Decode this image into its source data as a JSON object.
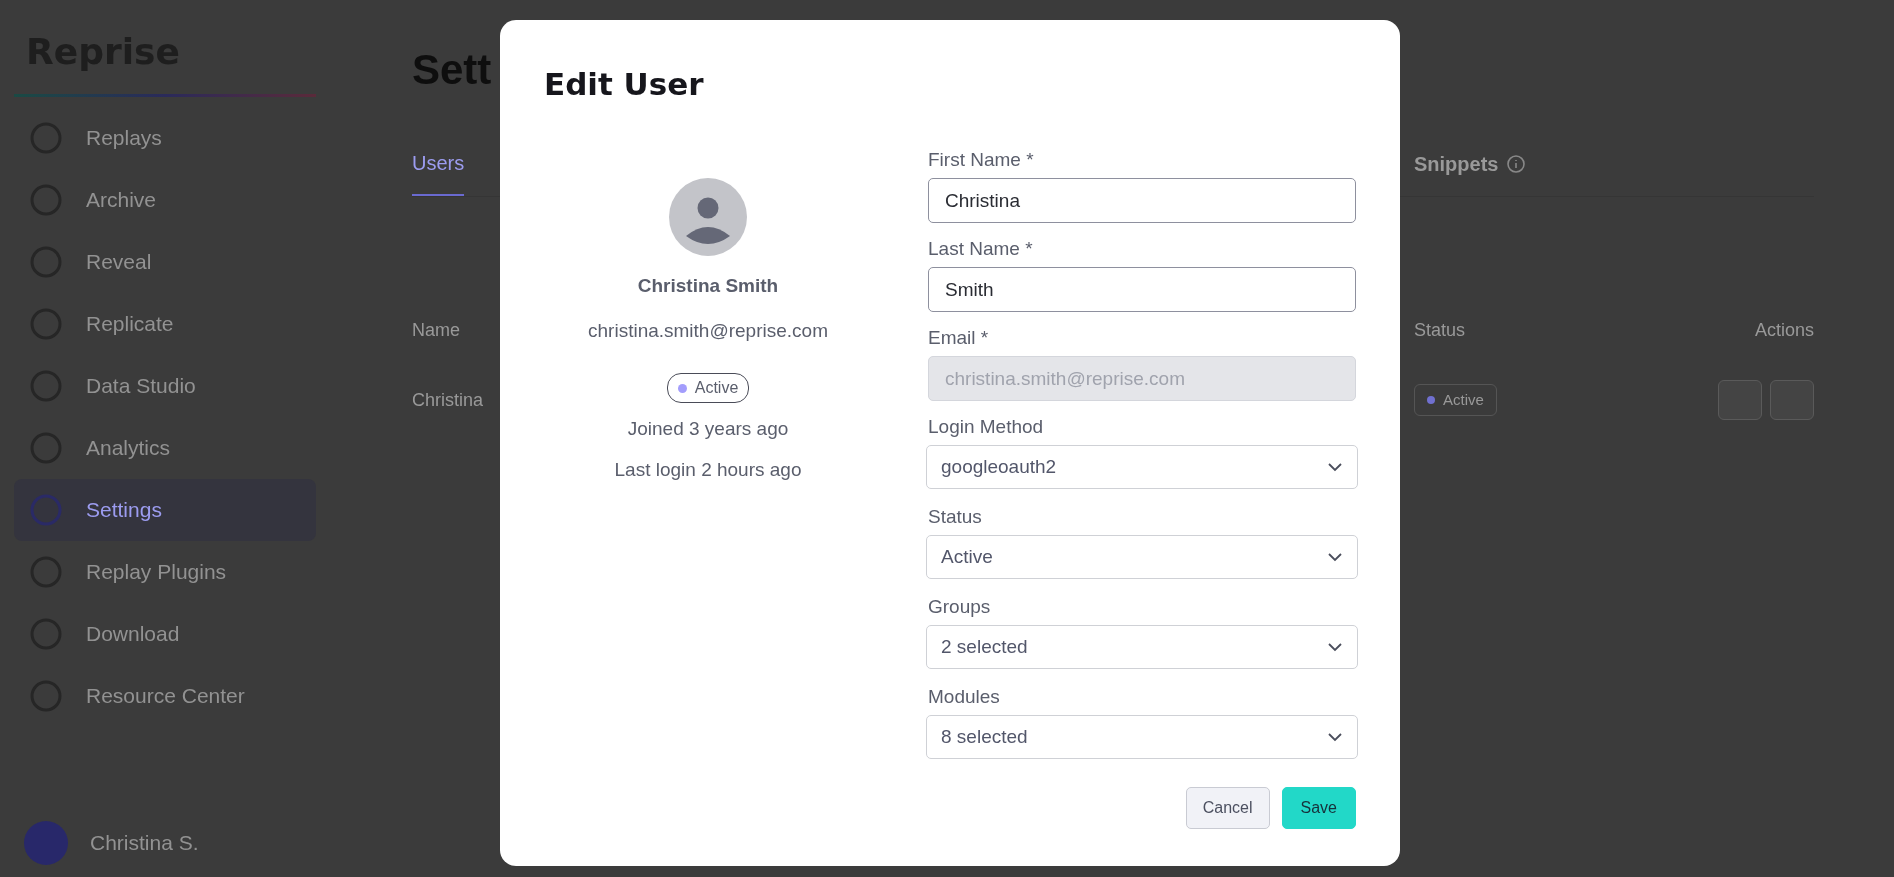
{
  "background": {
    "logo": "Reprise",
    "sidebar": {
      "items": [
        {
          "label": "Replays",
          "selected": false
        },
        {
          "label": "Archive",
          "selected": false
        },
        {
          "label": "Reveal",
          "selected": false
        },
        {
          "label": "Replicate",
          "selected": false
        },
        {
          "label": "Data Studio",
          "selected": false
        },
        {
          "label": "Analytics",
          "selected": false
        },
        {
          "label": "Settings",
          "selected": true
        },
        {
          "label": "Replay Plugins",
          "selected": false
        },
        {
          "label": "Download",
          "selected": false
        },
        {
          "label": "Resource Center",
          "selected": false
        }
      ],
      "user": "Christina S."
    },
    "page_title": "Sett",
    "tabs": [
      {
        "label": "Users",
        "selected": true
      },
      {
        "label": "Snippets",
        "selected": false
      }
    ],
    "table": {
      "columns": [
        "Name",
        "Status",
        "Actions"
      ],
      "rows": [
        {
          "name": "Christina",
          "status": "Active"
        }
      ]
    }
  },
  "modal": {
    "title": "Edit User",
    "profile": {
      "name": "Christina Smith",
      "email": "christina.smith@reprise.com",
      "status": "Active",
      "joined": "Joined 3 years ago",
      "last_login": "Last login 2 hours ago"
    },
    "fields": [
      {
        "label": "First Name *",
        "kind": "text",
        "value": "Christina",
        "disabled": false
      },
      {
        "label": "Last Name *",
        "kind": "text",
        "value": "Smith",
        "disabled": false
      },
      {
        "label": "Email *",
        "kind": "text",
        "value": "christina.smith@reprise.com",
        "disabled": true
      },
      {
        "label": "Login Method",
        "kind": "select",
        "value": "googleoauth2"
      },
      {
        "label": "Status",
        "kind": "select",
        "value": "Active"
      },
      {
        "label": "Groups",
        "kind": "select",
        "value": "2 selected"
      },
      {
        "label": "Modules",
        "kind": "select",
        "value": "8 selected"
      }
    ],
    "buttons": [
      {
        "label": "Cancel",
        "kind": "secondary"
      },
      {
        "label": "Save",
        "kind": "primary"
      }
    ]
  }
}
